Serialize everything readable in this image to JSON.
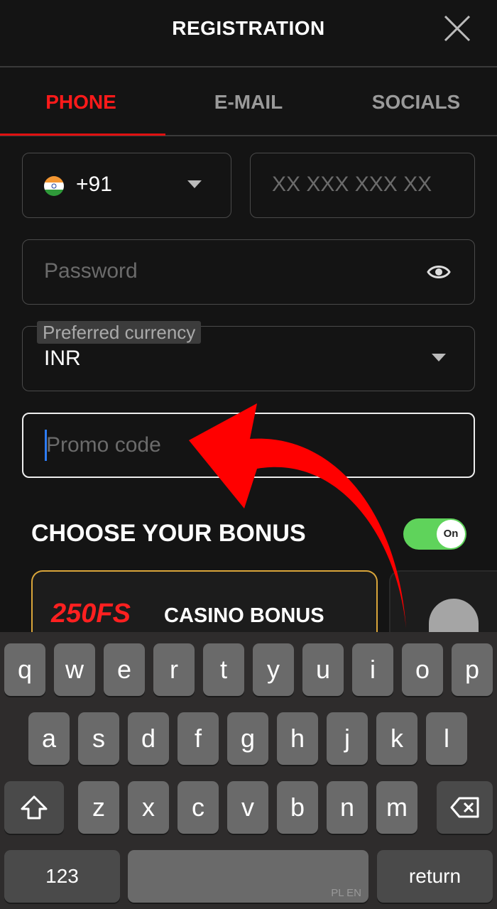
{
  "header": {
    "title": "REGISTRATION",
    "close_icon": "close-icon"
  },
  "tabs": [
    {
      "label": "PHONE",
      "active": true
    },
    {
      "label": "E-MAIL",
      "active": false
    },
    {
      "label": "SOCIALS",
      "active": false
    }
  ],
  "form": {
    "country_code": "+91",
    "country_flag": "india-flag-icon",
    "phone_placeholder": "XX XXX XXX XX",
    "password_placeholder": "Password",
    "currency_label": "Preferred currency",
    "currency_value": "INR",
    "promo_placeholder": "Promo code"
  },
  "bonus": {
    "title": "CHOOSE YOUR BONUS",
    "toggle_label": "On",
    "toggle_on": true,
    "cards": [
      {
        "badge": "250FS",
        "title": "CASINO BONUS"
      }
    ]
  },
  "colors": {
    "accent": "#ff1a1a",
    "toggle": "#5fd35b",
    "card_border": "#d9a53a",
    "arrow": "#ff0000"
  },
  "keyboard": {
    "row1": [
      "q",
      "w",
      "e",
      "r",
      "t",
      "y",
      "u",
      "i",
      "o",
      "p"
    ],
    "row2": [
      "a",
      "s",
      "d",
      "f",
      "g",
      "h",
      "j",
      "k",
      "l"
    ],
    "row3": [
      "z",
      "x",
      "c",
      "v",
      "b",
      "n",
      "m"
    ],
    "numbers": "123",
    "space_lang": "PL EN",
    "return": "return"
  }
}
